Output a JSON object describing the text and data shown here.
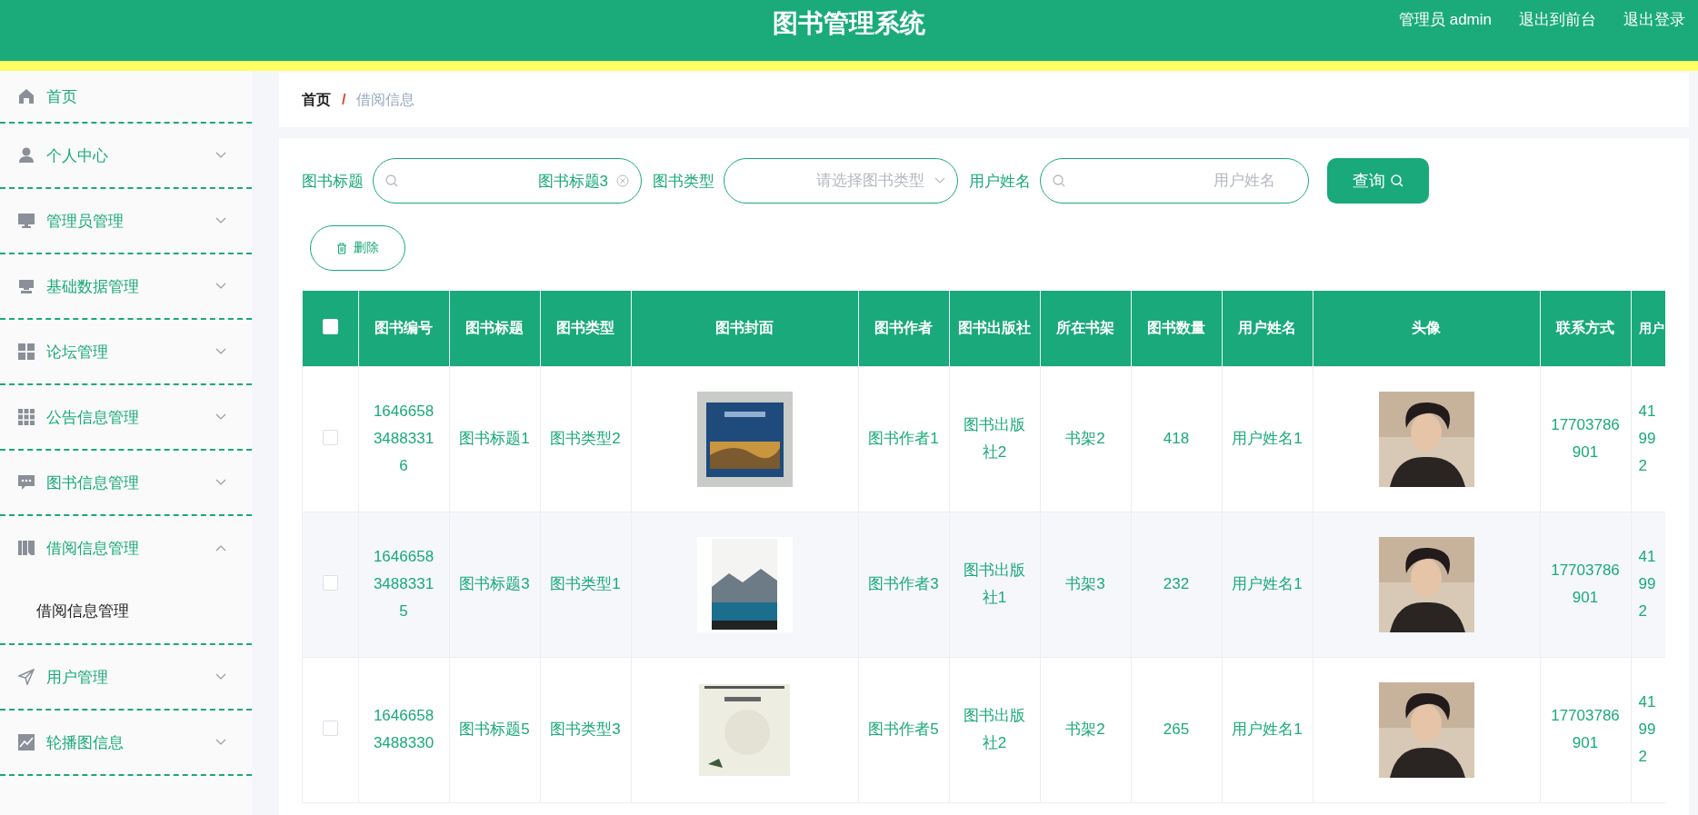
{
  "header": {
    "title": "图书管理系统",
    "links": [
      {
        "label": "管理员 admin"
      },
      {
        "label": "退出到前台"
      },
      {
        "label": "退出登录"
      }
    ]
  },
  "sidebar": {
    "items": [
      {
        "label": "首页",
        "kind": "link"
      },
      {
        "label": "个人中心",
        "kind": "menu",
        "expanded": false
      },
      {
        "label": "管理员管理",
        "kind": "menu",
        "expanded": false
      },
      {
        "label": "基础数据管理",
        "kind": "menu",
        "expanded": false
      },
      {
        "label": "论坛管理",
        "kind": "menu",
        "expanded": false
      },
      {
        "label": "公告信息管理",
        "kind": "menu",
        "expanded": false
      },
      {
        "label": "图书信息管理",
        "kind": "menu",
        "expanded": false
      },
      {
        "label": "借阅信息管理",
        "kind": "menu",
        "expanded": true,
        "children": [
          {
            "label": "借阅信息管理"
          }
        ]
      },
      {
        "label": "用户管理",
        "kind": "menu",
        "expanded": false
      },
      {
        "label": "轮播图信息",
        "kind": "menu",
        "expanded": false
      }
    ]
  },
  "breadcrumb": [
    {
      "label": "首页"
    },
    {
      "label": "借阅信息"
    }
  ],
  "breadcrumb_separator": "/",
  "filters": [
    {
      "label": "图书标题",
      "kind": "text",
      "value": "图书标题3"
    },
    {
      "label": "图书类型",
      "kind": "select",
      "placeholder": "请选择图书类型"
    },
    {
      "label": "用户姓名",
      "kind": "text",
      "placeholder": "用户姓名"
    }
  ],
  "search_button": "查询",
  "delete_button": "删除",
  "table": {
    "select_all_checked": false,
    "columns": [
      "图书编号",
      "图书标题",
      "图书类型",
      "图书封面",
      "图书作者",
      "图书出版社",
      "所在书架",
      "图书数量",
      "用户姓名",
      "头像",
      "联系方式",
      "用户"
    ],
    "rows": [
      {
        "checked": false,
        "cells": [
          "164665834883316",
          "图书标题1",
          "图书类型2",
          {
            "kind": "picture"
          },
          "图书作者1",
          "图书出版社2",
          "书架2",
          "418",
          "用户姓名1",
          {
            "kind": "picture"
          },
          "17703786901",
          "41 99 2"
        ]
      },
      {
        "checked": false,
        "cells": [
          "164665834883315",
          "图书标题3",
          "图书类型1",
          {
            "kind": "picture"
          },
          "图书作者3",
          "图书出版社1",
          "书架3",
          "232",
          "用户姓名1",
          {
            "kind": "picture"
          },
          "17703786901",
          "41 99 2"
        ]
      },
      {
        "checked": false,
        "cells": [
          "16466583488330",
          "图书标题5",
          "图书类型3",
          {
            "kind": "picture"
          },
          "图书作者5",
          "图书出版社2",
          "书架2",
          "265",
          "用户姓名1",
          {
            "kind": "picture"
          },
          "17703786901",
          "41 99 2"
        ]
      }
    ]
  }
}
